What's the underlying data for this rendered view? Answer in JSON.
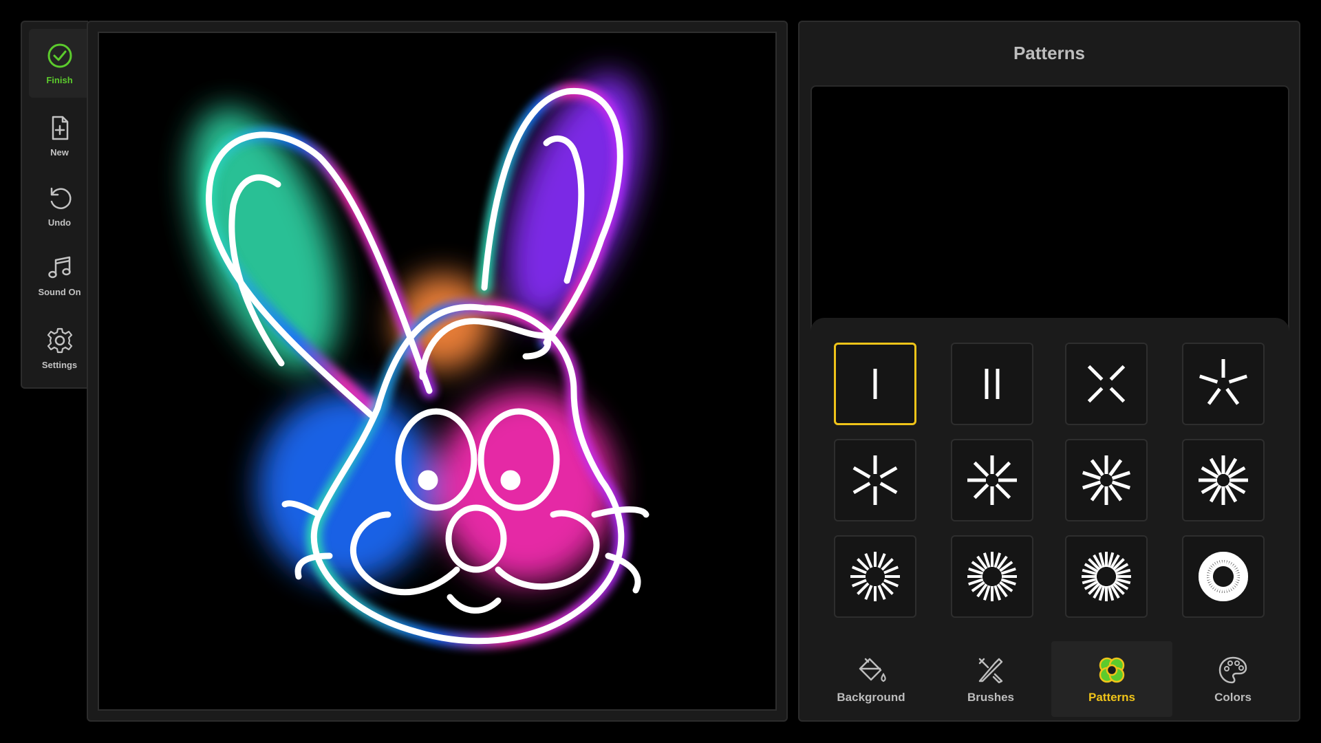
{
  "toolbar": {
    "items": [
      {
        "label": "Finish",
        "icon": "check-circle-icon",
        "active": true
      },
      {
        "label": "New",
        "icon": "new-file-icon"
      },
      {
        "label": "Undo",
        "icon": "undo-icon"
      },
      {
        "label": "Sound On",
        "icon": "music-note-icon"
      },
      {
        "label": "Settings",
        "icon": "gear-icon"
      }
    ]
  },
  "canvas": {
    "drawing": "neon-rabbit-drawing"
  },
  "panel": {
    "title": "Patterns",
    "patterns": [
      {
        "rays": 1,
        "selected": true
      },
      {
        "rays": 2
      },
      {
        "rays": 4
      },
      {
        "rays": 5
      },
      {
        "rays": 6
      },
      {
        "rays": 8
      },
      {
        "rays": 10
      },
      {
        "rays": 12
      },
      {
        "rays": 16
      },
      {
        "rays": 20
      },
      {
        "rays": 24
      },
      {
        "rays": 40
      }
    ]
  },
  "tabs": [
    {
      "label": "Background",
      "icon": "paint-bucket-icon"
    },
    {
      "label": "Brushes",
      "icon": "brushes-icon"
    },
    {
      "label": "Patterns",
      "icon": "flower-pattern-icon",
      "active": true
    },
    {
      "label": "Colors",
      "icon": "palette-icon"
    }
  ],
  "colors": {
    "accent_green": "#5ccb2d",
    "accent_yellow": "#f0c419",
    "panel_bg": "#1b1b1b"
  }
}
